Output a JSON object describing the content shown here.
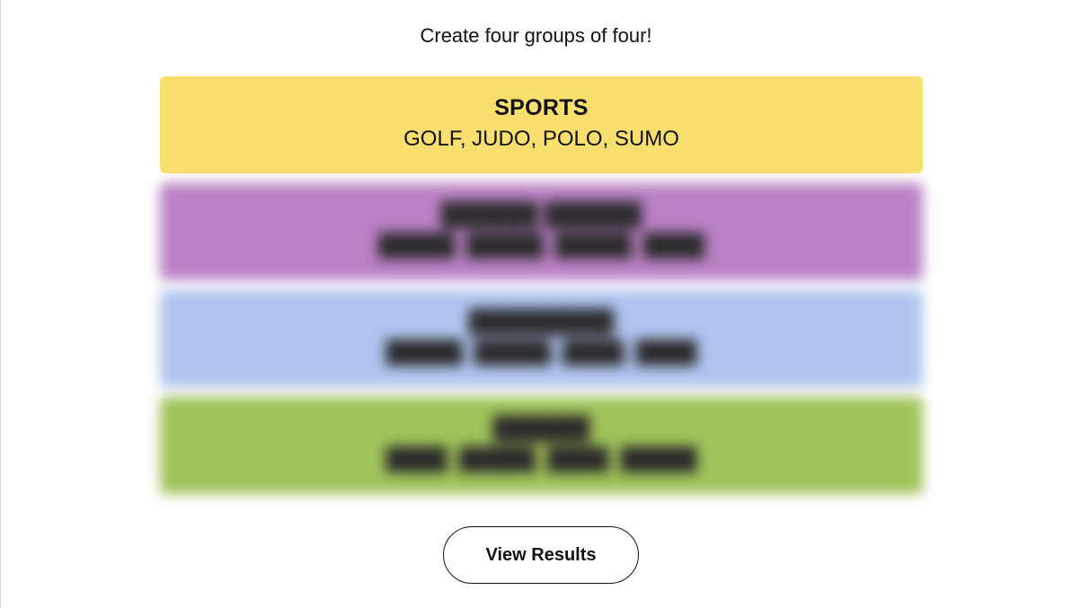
{
  "header": {
    "subtitle": "Create four groups of four!"
  },
  "groups": [
    {
      "title": "SPORTS",
      "members": "GOLF, JUDO, POLO, SUMO",
      "color": "#f9df6d",
      "revealed": true
    },
    {
      "title": "",
      "members": "",
      "color": "#ba81c5",
      "revealed": false
    },
    {
      "title": "",
      "members": "",
      "color": "#b0c4ef",
      "revealed": false
    },
    {
      "title": "",
      "members": "",
      "color": "#a0c35a",
      "revealed": false
    }
  ],
  "actions": {
    "view_results_label": "View Results"
  }
}
